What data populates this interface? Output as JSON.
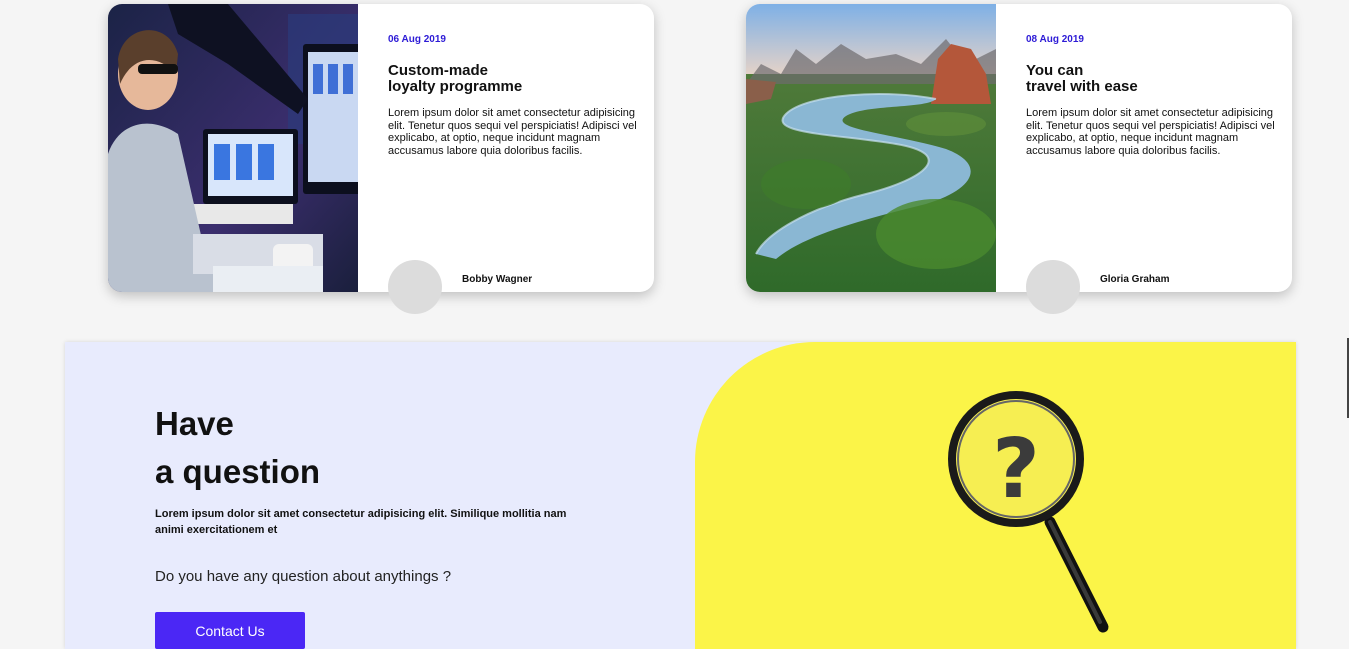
{
  "cards": [
    {
      "date": "06 Aug 2019",
      "title_line1": "Custom-made",
      "title_line2": "loyalty programme",
      "description": "Lorem ipsum dolor sit amet consectetur adipisicing elit. Tenetur quos sequi vel perspiciatis! Adipisci vel explicabo, at optio, neque incidunt magnam accusamus labore quia doloribus facilis.",
      "author": "Bobby Wagner"
    },
    {
      "date": "08 Aug 2019",
      "title_line1": "You can",
      "title_line2": "travel with ease",
      "description": "Lorem ipsum dolor sit amet consectetur adipisicing elit. Tenetur quos sequi vel perspiciatis! Adipisci vel explicabo, at optio, neque incidunt magnam accusamus labore quia doloribus facilis.",
      "author": "Gloria Graham"
    }
  ],
  "question": {
    "heading_line1": "Have",
    "heading_line2": "a question",
    "subtext": "Lorem ipsum dolor sit amet consectetur adipisicing elit. Similique mollitia nam animi exercitationem et",
    "prompt": "Do you have any question about anythings ?",
    "button_label": "Contact Us",
    "image_glyph": "?"
  },
  "colors": {
    "accent": "#4b27f5",
    "date": "#2d1bd6",
    "panel_bg": "#e8ebfd",
    "yellow": "#fbf448"
  },
  "icons": [
    "magnifying-glass-question-icon"
  ]
}
